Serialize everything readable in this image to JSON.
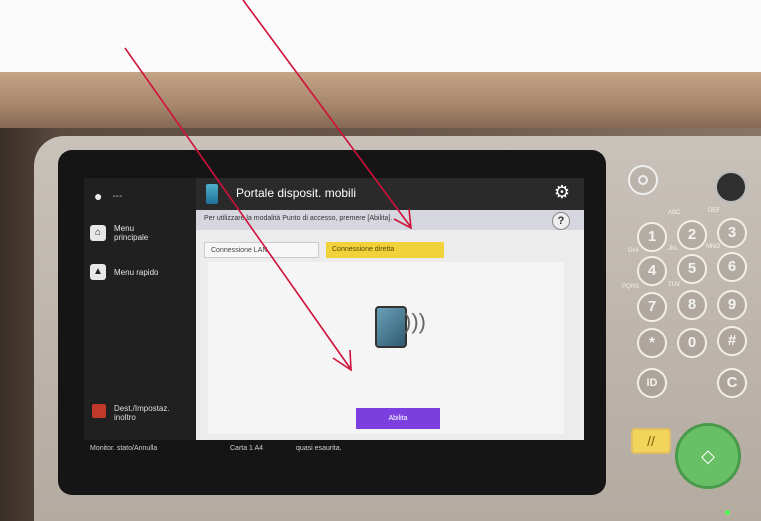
{
  "screen": {
    "sidebar": {
      "user_label": "---",
      "items": [
        {
          "label": "Menu principale",
          "icon": "home-icon"
        },
        {
          "label": "Menu rapido",
          "icon": "quick-menu-icon"
        }
      ],
      "bottom_label": "Dest./Impostaz. inoltro"
    },
    "topbar": {
      "title": "Portale disposit. mobili",
      "settings_icon": "gear-icon"
    },
    "infobar": {
      "text": "Per utilizzare la modalità Punto di accesso, premere [Abilita].",
      "help_label": "?"
    },
    "tabs": [
      {
        "label": "Connessione LAN",
        "selected": false
      },
      {
        "label": "Connessione diretta",
        "selected": true
      }
    ],
    "enable_button": "Abilita",
    "statusbar": {
      "monitor_label": "Monitor. stato/Annulla",
      "paper_label": "Carta  1  A4",
      "paper_status": "quasi esaurita."
    }
  },
  "keypad": {
    "keys": [
      "1",
      "2",
      "3",
      "4",
      "5",
      "6",
      "7",
      "8",
      "9",
      "*",
      "0",
      "#",
      "ID",
      "C"
    ],
    "letters": [
      "ABC",
      "DEF",
      "GHI",
      "JKL",
      "MNO",
      "PQRS",
      "TUV"
    ]
  },
  "colors": {
    "tab_selected": "#f1d23a",
    "enable_button": "#7b3fe0",
    "annotation_arrow": "#d0103a",
    "start_button": "#67c066"
  }
}
